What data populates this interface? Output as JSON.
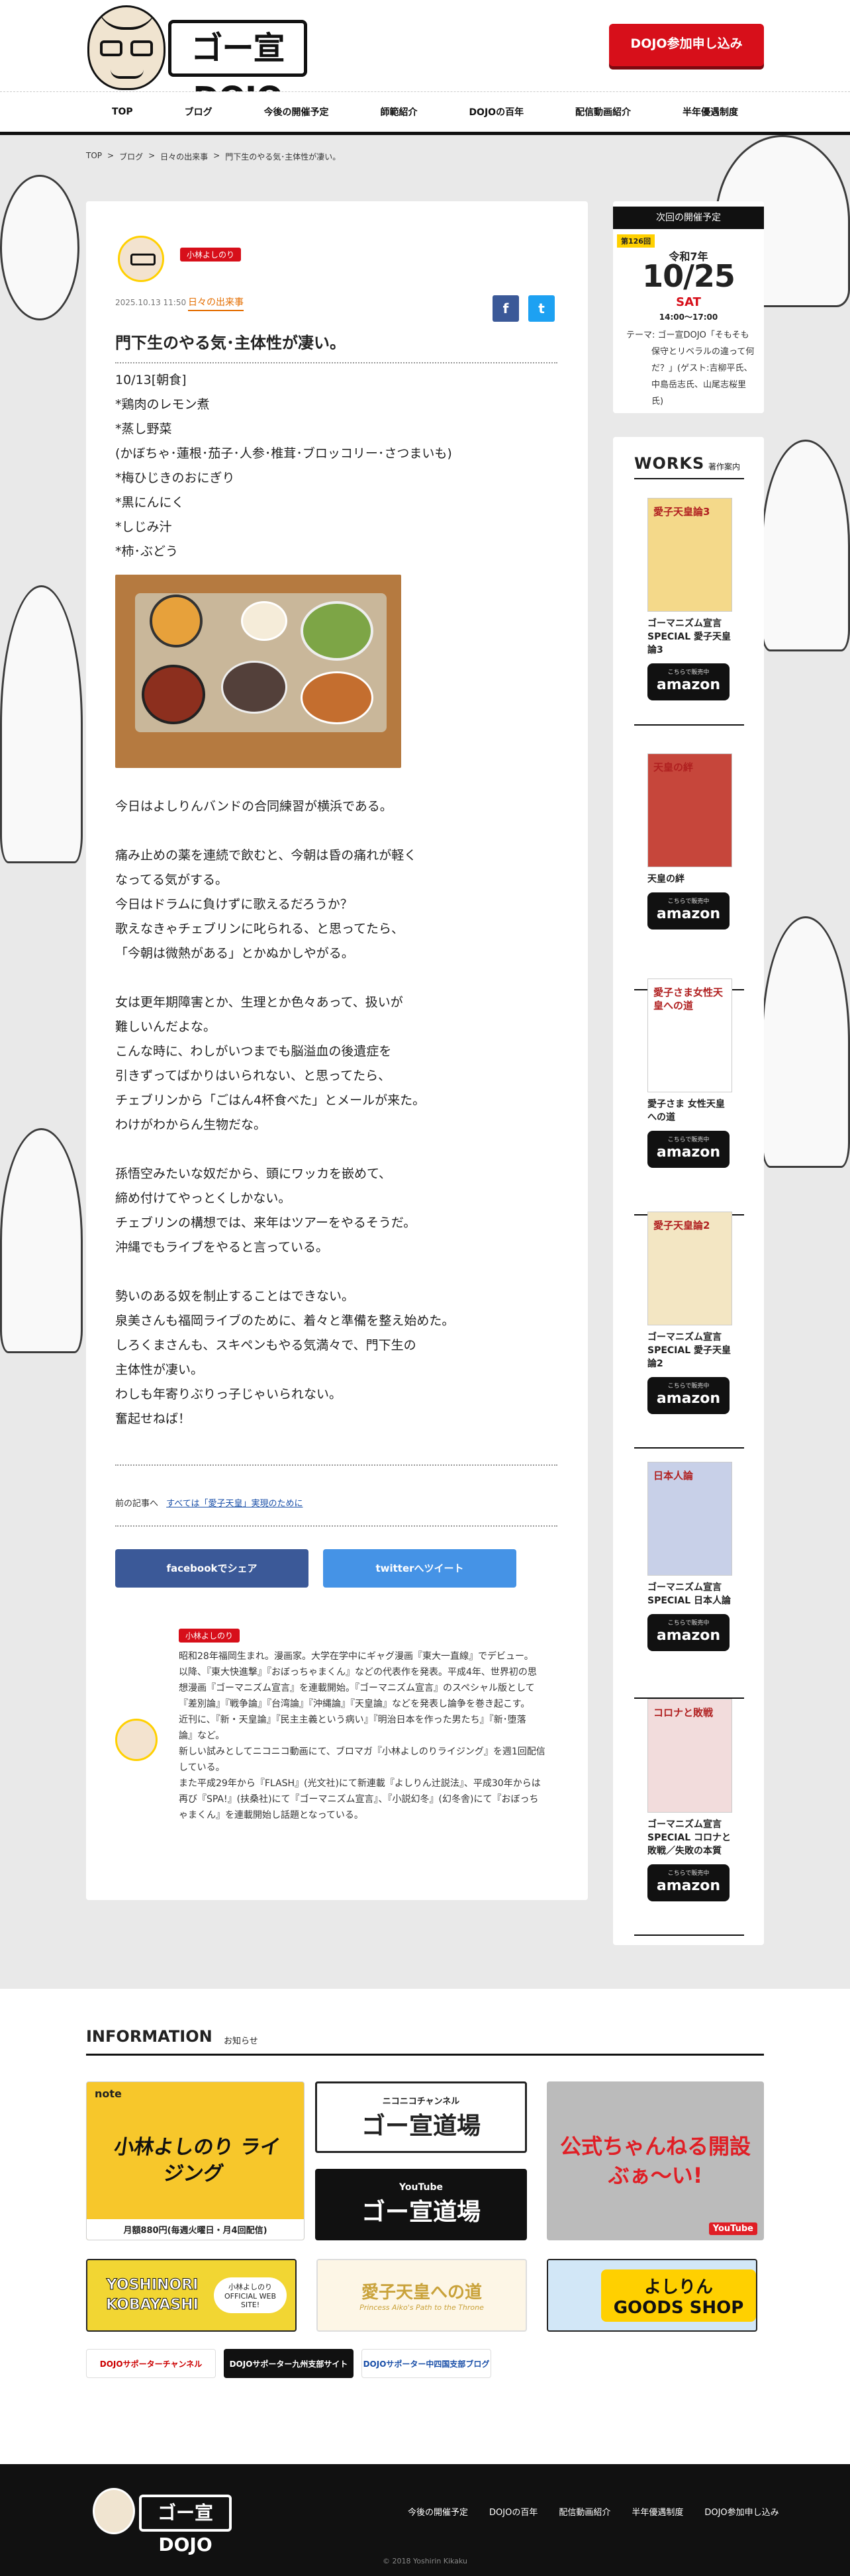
{
  "logo": {
    "text": "ゴー宣DOJO"
  },
  "header": {
    "cta": "DOJO参加申し込み"
  },
  "nav": [
    "TOP",
    "ブログ",
    "今後の開催予定",
    "師範紹介",
    "DOJOの百年",
    "配信動画紹介",
    "半年優遇制度"
  ],
  "breadcrumb": [
    "TOP",
    ">",
    "ブログ",
    ">",
    "日々の出来事",
    ">",
    "門下生のやる気･主体性が凄い。"
  ],
  "article": {
    "author_tag": "小林よしのり",
    "date": "2025.10.13 11:50",
    "category": "日々の出来事",
    "share_fb_icon": "f",
    "share_tw_icon": "t",
    "title": "門下生のやる気･主体性が凄い。",
    "intro": "10/13[朝食]\n*鶏肉のレモン煮\n*蒸し野菜\n(かぼちゃ･蓮根･茄子･人参･椎茸･ブロッコリー･さつまいも)\n*梅ひじきのおにぎり\n*黒にんにく\n*しじみ汁\n*柿･ぶどう",
    "paragraphs": [
      "今日はよしりんバンドの合同練習が横浜である。",
      "痛み止めの薬を連続で飲むと、今朝は昏の痛れが軽く\nなってる気がする。\n今日はドラムに負けずに歌えるだろうか？\n歌えなきゃチェブリンに叱られる、と思ってたら、\n「今朝は微熱がある」とかぬかしやがる。",
      "女は更年期障害とか、生理とか色々あって、扱いが\n難しいんだよな。\nこんな時に、わしがいつまでも脳溢血の後遺症を\n引きずってばかりはいられない、と思ってたら、\nチェブリンから「ごはん4杯食べた」とメールが来た。\nわけがわからん生物だな。",
      "孫悟空みたいな奴だから、頭にワッカを嵌めて、\n締め付けてやっとくしかない。\nチェブリンの構想では、来年はツアーをやるそうだ。\n沖縄でもライブをやると言っている。",
      "勢いのある奴を制止することはできない。\n泉美さんも福岡ライブのために、着々と準備を整え始めた。\nしろくまさんも、スキペンもやる気満々で、門下生の\n主体性が凄い。\nわしも年寄りぶりっ子じゃいられない。\n奮起せねば！"
    ],
    "prev_label": "前の記事へ",
    "prev_link": "すべては「愛子天皇」実現のために",
    "share_fb": "facebookでシェア",
    "share_tw": "twitterへツイート",
    "author_bio_tag": "小林よしのり",
    "author_bio": "昭和28年福岡生まれ。漫画家。大学在学中にギャグ漫画『東大一直線』でデビュー。\n以降、『東大快進撃』『おぼっちゃまくん』などの代表作を発表。平成4年、世界初の思\n想漫画『ゴーマニズム宣言』を連載開始。『ゴーマニズム宣言』のスペシャル版として\n『差別論』『戦争論』『台湾論』『沖縄論』『天皇論』などを発表し論争を巻き起こす。\n近刊に、『新・天皇論』『民主主義という病い』『明治日本を作った男たち』『新･堕落\n論』など。\n新しい試みとしてニコニコ動画にて、ブロマガ『小林よしのりライジング』を週1回配信\nしている。\nまた平成29年から『FLASH』(光文社)にて新連載『よしりん辻説法』、平成30年からは\n再び『SPA!』(扶桑社)にて『ゴーマニズム宣言』、『小説幻冬』(幻冬舎)にて『おぼっち\nゃまくん』を連載開始し話題となっている。"
  },
  "schedule": {
    "header": "次回の開催予定",
    "badge": "第126回",
    "era": "令和7年",
    "date": "10/25",
    "dow": "SAT",
    "time": "14:00～17:00",
    "theme": "テーマ: ゴー宣DOJO「そもそも保守とリベラルの違って何だ？」(ゲスト:吉柳平氏、中島岳志氏、山尾志桜里氏)"
  },
  "works": {
    "header": "WORKS",
    "sub": "著作案内",
    "amazon_small": "こちらで販売中",
    "amazon_label": "amazon",
    "items": [
      {
        "title": "ゴーマニズム宣言\nSPECIAL 愛子天皇\n論3",
        "cover_color": "#f4d98a",
        "cover_label": "愛子天皇論3"
      },
      {
        "title": "天皇の絆",
        "cover_color": "#c6463b",
        "cover_label": "天皇の絆"
      },
      {
        "title": "愛子さま 女性天皇\nへの道",
        "cover_color": "#ffffff",
        "cover_label": "愛子さま女性天皇への道"
      },
      {
        "title": "ゴーマニズム宣言\nSPECIAL 愛子天皇\n論2",
        "cover_color": "#f3e6c3",
        "cover_label": "愛子天皇論2"
      },
      {
        "title": "ゴーマニズム宣言\nSPECIAL 日本人論",
        "cover_color": "#c8d0e8",
        "cover_label": "日本人論"
      },
      {
        "title": "ゴーマニズム宣言\nSPECIAL コロナと\n敗戦／失敗の本質",
        "cover_color": "#f2dcdc",
        "cover_label": "コロナと敗戦"
      }
    ]
  },
  "information": {
    "title": "INFORMATION",
    "sub": "お知らせ",
    "banners": [
      {
        "label": "小林よしのり ライジング",
        "note": "note",
        "sub": "月額880円(毎週火曜日・月4回配信)",
        "bg": "#f7c72b"
      },
      {
        "label": "ゴー宣道場",
        "note": "ニコニコチャンネル",
        "bg": "#ffffff"
      },
      {
        "label": "ゴー宣道場",
        "note": "YouTube",
        "bg": "#111111"
      },
      {
        "label": "公式ちゃんねる開設ぶぁ～い!",
        "note": "YouTube",
        "bg": "#e85a1f"
      },
      {
        "label": "YOSHINORI KOBAYASHI",
        "note": "小林よしのり OFFICIAL WEB SITE!",
        "bg": "#f2d633"
      },
      {
        "label": "愛子天皇への道",
        "note": "Princess Aiko's Path to the Throne",
        "bg": "#fdf6e6"
      },
      {
        "label": "よしりん GOODS SHOP",
        "note": "",
        "bg": "#d2e7f7"
      }
    ],
    "mini": [
      "DOJOサポーターチャンネル",
      "DOJOサポーター九州支部サイト",
      "DOJOサポーター中四国支部ブログ"
    ]
  },
  "footer": {
    "nav": [
      "今後の開催予定",
      "DOJOの百年",
      "配信動画紹介",
      "半年優遇制度",
      "DOJO参加申し込み"
    ],
    "copyright": "© 2018 Yoshirin Kikaku"
  }
}
